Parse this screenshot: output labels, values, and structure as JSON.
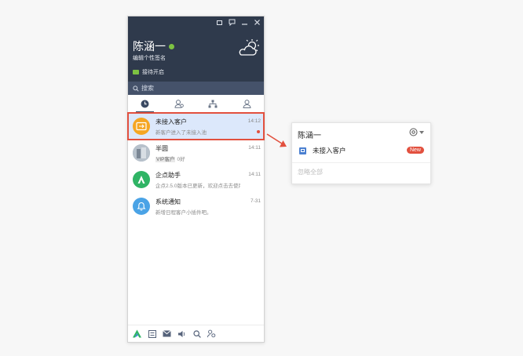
{
  "window": {
    "profile_name": "陈涵一",
    "signature": "编辑个性签名",
    "status": "接待开启",
    "search_placeholder": "搜索"
  },
  "tabs": [
    {
      "icon": "clock-icon",
      "active": true
    },
    {
      "icon": "contacts-icon",
      "active": false
    },
    {
      "icon": "org-tree-icon",
      "active": false
    },
    {
      "icon": "user-icon",
      "active": false
    }
  ],
  "conversations": [
    {
      "title": "未接入客户",
      "subtitle": "新客户进入了未接入池",
      "time": "14:12",
      "unread": true,
      "selected": true,
      "avatar_color": "#f5a623",
      "icon": "queue-icon"
    },
    {
      "title": "半圆",
      "tag": "VIP客户",
      "subtitle": "0好",
      "time": "14:11",
      "unread": false,
      "selected": false,
      "avatar_color": "#9aa7b4",
      "icon": "photo-avatar"
    },
    {
      "title": "企点助手",
      "subtitle": "企点2.5.0版本已更新，欢迎点击去使用",
      "time": "14:11",
      "unread": false,
      "selected": false,
      "avatar_color": "#2fb465",
      "icon": "assistant-icon"
    },
    {
      "title": "系统通知",
      "subtitle": "新增日程客户小插件吧。",
      "time": "7-31",
      "unread": false,
      "selected": false,
      "avatar_color": "#4aa3e6",
      "icon": "bell-icon"
    }
  ],
  "popup": {
    "title": "陈涵一",
    "item_label": "未接入客户",
    "badge": "New",
    "ignore_all": "忽略全部"
  },
  "colors": {
    "header_bg": "#2f3a4c",
    "selected_bg": "#dce8fb",
    "highlight_red": "#e2503e",
    "online_green": "#7dc242"
  }
}
